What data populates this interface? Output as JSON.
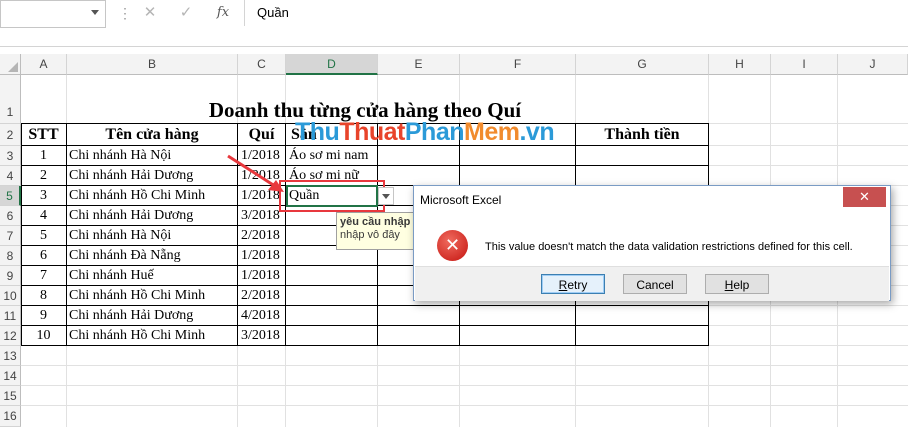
{
  "formula_bar": {
    "name_box": "",
    "content": "Quần",
    "fx": "fx",
    "cancel": "✕",
    "enter": "✓",
    "sep": "⋮"
  },
  "columns": [
    "A",
    "B",
    "C",
    "D",
    "E",
    "F",
    "G",
    "H",
    "I",
    "J"
  ],
  "rows": [
    "1",
    "2",
    "3",
    "4",
    "5",
    "6",
    "7",
    "8",
    "9",
    "10",
    "11",
    "12",
    "13",
    "14",
    "15",
    "16"
  ],
  "sheet": {
    "title": "Doanh thu từng cửa hàng theo Quí",
    "headers": {
      "stt": "STT",
      "store": "Tên cửa hàng",
      "quarter": "Quí",
      "product": "Sản",
      "total": "Thành tiền"
    },
    "data": [
      {
        "stt": "1",
        "store": "Chi nhánh Hà Nội",
        "q": "1/2018",
        "product": "Áo sơ mi nam"
      },
      {
        "stt": "2",
        "store": "Chi nhánh Hải Dương",
        "q": "1/2018",
        "product": "Áo sơ mi nữ"
      },
      {
        "stt": "3",
        "store": "Chi nhánh Hồ Chi Minh",
        "q": "1/2018",
        "product": "Quần"
      },
      {
        "stt": "4",
        "store": "Chi nhánh Hải Dương",
        "q": "3/2018",
        "product": ""
      },
      {
        "stt": "5",
        "store": "Chi nhánh Hà Nội",
        "q": "2/2018",
        "product": ""
      },
      {
        "stt": "6",
        "store": "Chi nhánh Đà Nẵng",
        "q": "1/2018",
        "product": ""
      },
      {
        "stt": "7",
        "store": "Chi nhánh Huế",
        "q": "1/2018",
        "product": ""
      },
      {
        "stt": "8",
        "store": "Chi nhánh Hồ Chi Minh",
        "q": "2/2018",
        "product": ""
      },
      {
        "stt": "9",
        "store": "Chi nhánh Hải Dương",
        "q": "4/2018",
        "product": ""
      },
      {
        "stt": "10",
        "store": "Chi nhánh Hồ Chi Minh",
        "q": "3/2018",
        "product": ""
      }
    ]
  },
  "tooltip": {
    "title": "yêu cầu nhập",
    "body": "nhập vô đây"
  },
  "watermark": {
    "part1": "Thu",
    "part2": "Thuat",
    "part3": "Phan",
    "part4": "Mem",
    "part5": ".vn"
  },
  "dialog": {
    "title": "Microsoft Excel",
    "close": "✕",
    "message": "This value doesn't match the data validation restrictions defined for this cell.",
    "retry_u": "R",
    "retry_rest": "etry",
    "cancel": "Cancel",
    "help_u": "H",
    "help_rest": "elp"
  },
  "colors": {
    "excel_green": "#217346",
    "highlight_red": "#e8383d",
    "error_red": "#c4140f"
  }
}
